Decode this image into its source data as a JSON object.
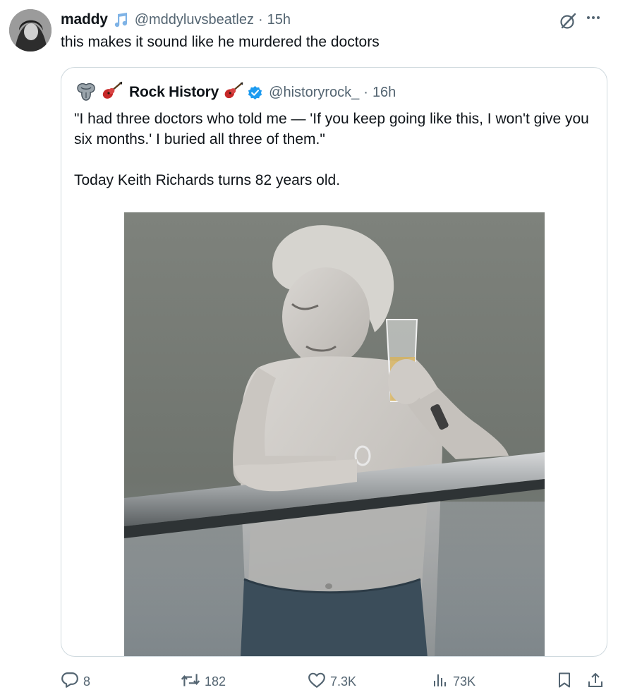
{
  "tweet": {
    "author_name": "maddy",
    "author_handle": "@mddyluvsbeatlez",
    "separator": "·",
    "time": "15h",
    "text": "this makes it sound like he murdered the doctors",
    "name_icon": "music-note-icon",
    "grok_icon": "grok-icon",
    "more_icon": "more-icon"
  },
  "quote": {
    "author_name": "Rock History",
    "author_handle": "@historyrock_",
    "separator": "·",
    "time": "16h",
    "name_prefix_icons": [
      "rolling-stones-tongue-icon",
      "guitar-icon"
    ],
    "name_suffix_icon": "guitar-icon",
    "verified_icon": "verified-badge-icon",
    "text": "\"I had three doctors who told me — 'If you keep going like this, I won't give you six months.' I buried all three of them.\"\n\nToday Keith Richards turns 82 years old."
  },
  "actions": {
    "replies": "8",
    "reposts": "182",
    "likes": "7.3K",
    "views": "73K",
    "icons": [
      "reply-icon",
      "repost-icon",
      "like-icon",
      "views-icon",
      "bookmark-icon",
      "share-icon"
    ]
  },
  "colors": {
    "text": "#0f1419",
    "secondary": "#536471",
    "border": "#cfd9de",
    "accent": "#1d9bf0",
    "note_icon": "#7fb3e6"
  }
}
